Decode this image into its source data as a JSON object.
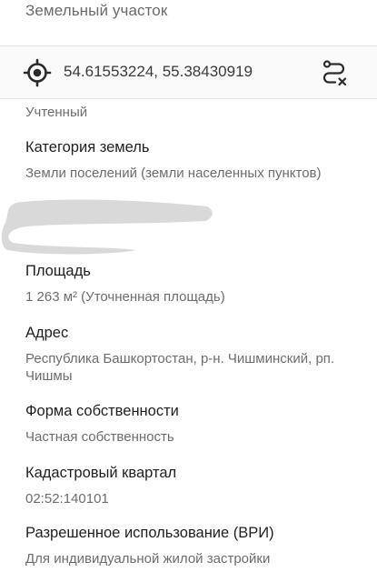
{
  "header": {
    "title": "Земельный участок"
  },
  "coords": {
    "text": "54.61553224, 55.38430919",
    "target_icon": "target-icon",
    "route_icon": "route-clear-icon"
  },
  "status": "Учтенный",
  "fields": {
    "category": {
      "label": "Категория земель",
      "value": "Земли поселений (земли населенных пунктов)"
    },
    "area": {
      "label": "Площадь",
      "value": "1 263 м² (Уточненная площадь)"
    },
    "address": {
      "label": "Адрес",
      "value": "Республика Башкортостан, р-н. Чишминский, рп. Чишмы"
    },
    "ownership": {
      "label": "Форма собственности",
      "value": "Частная собственность"
    },
    "cadastral": {
      "label": "Кадастровый квартал",
      "value": "02:52:140101"
    },
    "usage": {
      "label": "Разрешенное использование (ВРИ)",
      "value": "Для индивидуальной жилой застройки"
    }
  },
  "colors": {
    "label": "#1f1f1f",
    "value": "#6d6d6d",
    "icon": "#2b2b2b",
    "redaction": "#d9d9d9"
  }
}
